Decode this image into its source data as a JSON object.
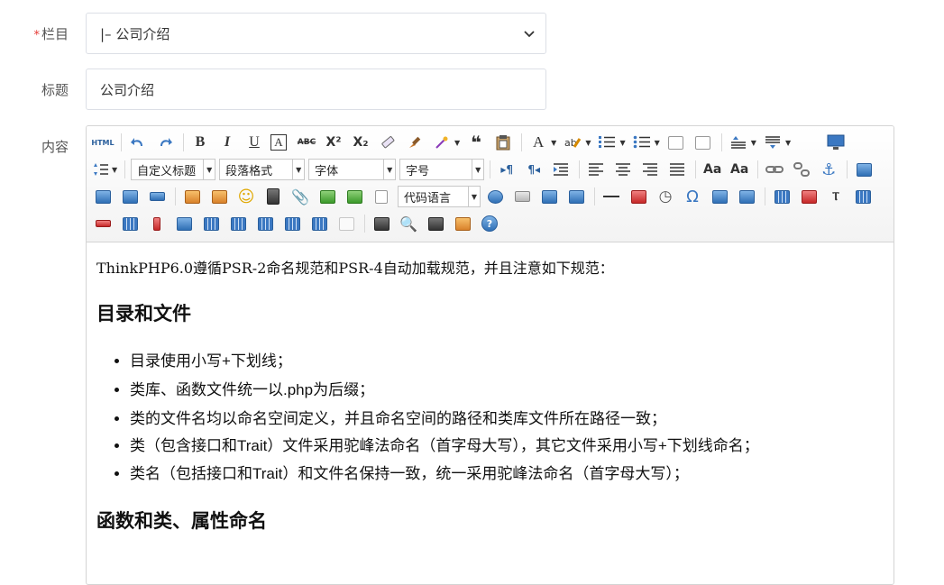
{
  "form": {
    "category_label": "栏目",
    "required_mark": "*",
    "category_value": "|– 公司介绍",
    "title_label": "标题",
    "title_value": "公司介绍",
    "content_label": "内容"
  },
  "toolbar": {
    "html_label": "HTML",
    "bold": "B",
    "italic": "I",
    "underline": "U",
    "fontborder": "A",
    "strikethrough": "ABC",
    "superscript": "X²",
    "subscript": "X₂",
    "blockquote": "❝",
    "forecolor": "A",
    "custom_title": "自定义标题",
    "paragraph_format": "段落格式",
    "font_family": "字体",
    "font_size": "字号",
    "code_language": "代码语言",
    "omega": "Ω",
    "help": "?"
  },
  "content": {
    "intro": "ThinkPHP6.0遵循PSR-2命名规范和PSR-4自动加载规范，并且注意如下规范：",
    "heading1": "目录和文件",
    "items": [
      "目录使用小写+下划线；",
      "类库、函数文件统一以.php为后缀；",
      "类的文件名均以命名空间定义，并且命名空间的路径和类库文件所在路径一致；",
      "类（包含接口和Trait）文件采用驼峰法命名（首字母大写），其它文件采用小写+下划线命名；",
      "类名（包括接口和Trait）和文件名保持一致，统一采用驼峰法命名（首字母大写）；"
    ],
    "heading2": "函数和类、属性命名"
  }
}
